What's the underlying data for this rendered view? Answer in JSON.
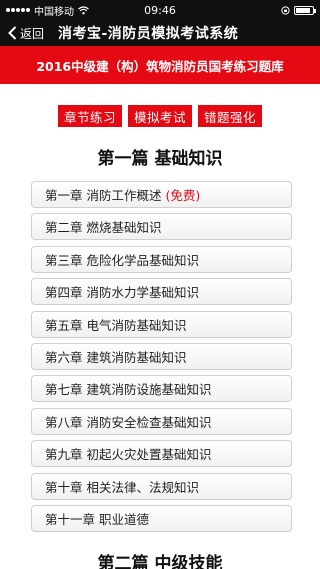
{
  "status_bar": {
    "carrier": "中国移动",
    "time": "09:46"
  },
  "nav": {
    "back_label": "返回",
    "title": "消考宝-消防员模拟考试系统"
  },
  "banner": {
    "text": "2016中级建（构）筑物消防员国考练习题库"
  },
  "tabs": [
    "章节练习",
    "模拟考试",
    "错题强化"
  ],
  "section1": {
    "title": "第一篇 基础知识"
  },
  "chapters": [
    {
      "label": "第一章 消防工作概述",
      "tag": "(免费)"
    },
    {
      "label": "第二章 燃烧基础知识",
      "tag": ""
    },
    {
      "label": "第三章 危险化学品基础知识",
      "tag": ""
    },
    {
      "label": "第四章 消防水力学基础知识",
      "tag": ""
    },
    {
      "label": "第五章 电气消防基础知识",
      "tag": ""
    },
    {
      "label": "第六章 建筑消防基础知识",
      "tag": ""
    },
    {
      "label": "第七章 建筑消防设施基础知识",
      "tag": ""
    },
    {
      "label": "第八章 消防安全检查基础知识",
      "tag": ""
    },
    {
      "label": "第九章 初起火灾处置基础知识",
      "tag": ""
    },
    {
      "label": "第十章 相关法律、法规知识",
      "tag": ""
    },
    {
      "label": "第十一章 职业道德",
      "tag": ""
    }
  ],
  "section2": {
    "title": "第二篇 中级技能"
  },
  "colors": {
    "accent": "#e50914",
    "nav_bg": "#101010"
  },
  "icons": {
    "back": "chevron-left-icon",
    "wifi": "wifi-icon",
    "battery": "battery-icon"
  },
  "battery_level": 0.85
}
